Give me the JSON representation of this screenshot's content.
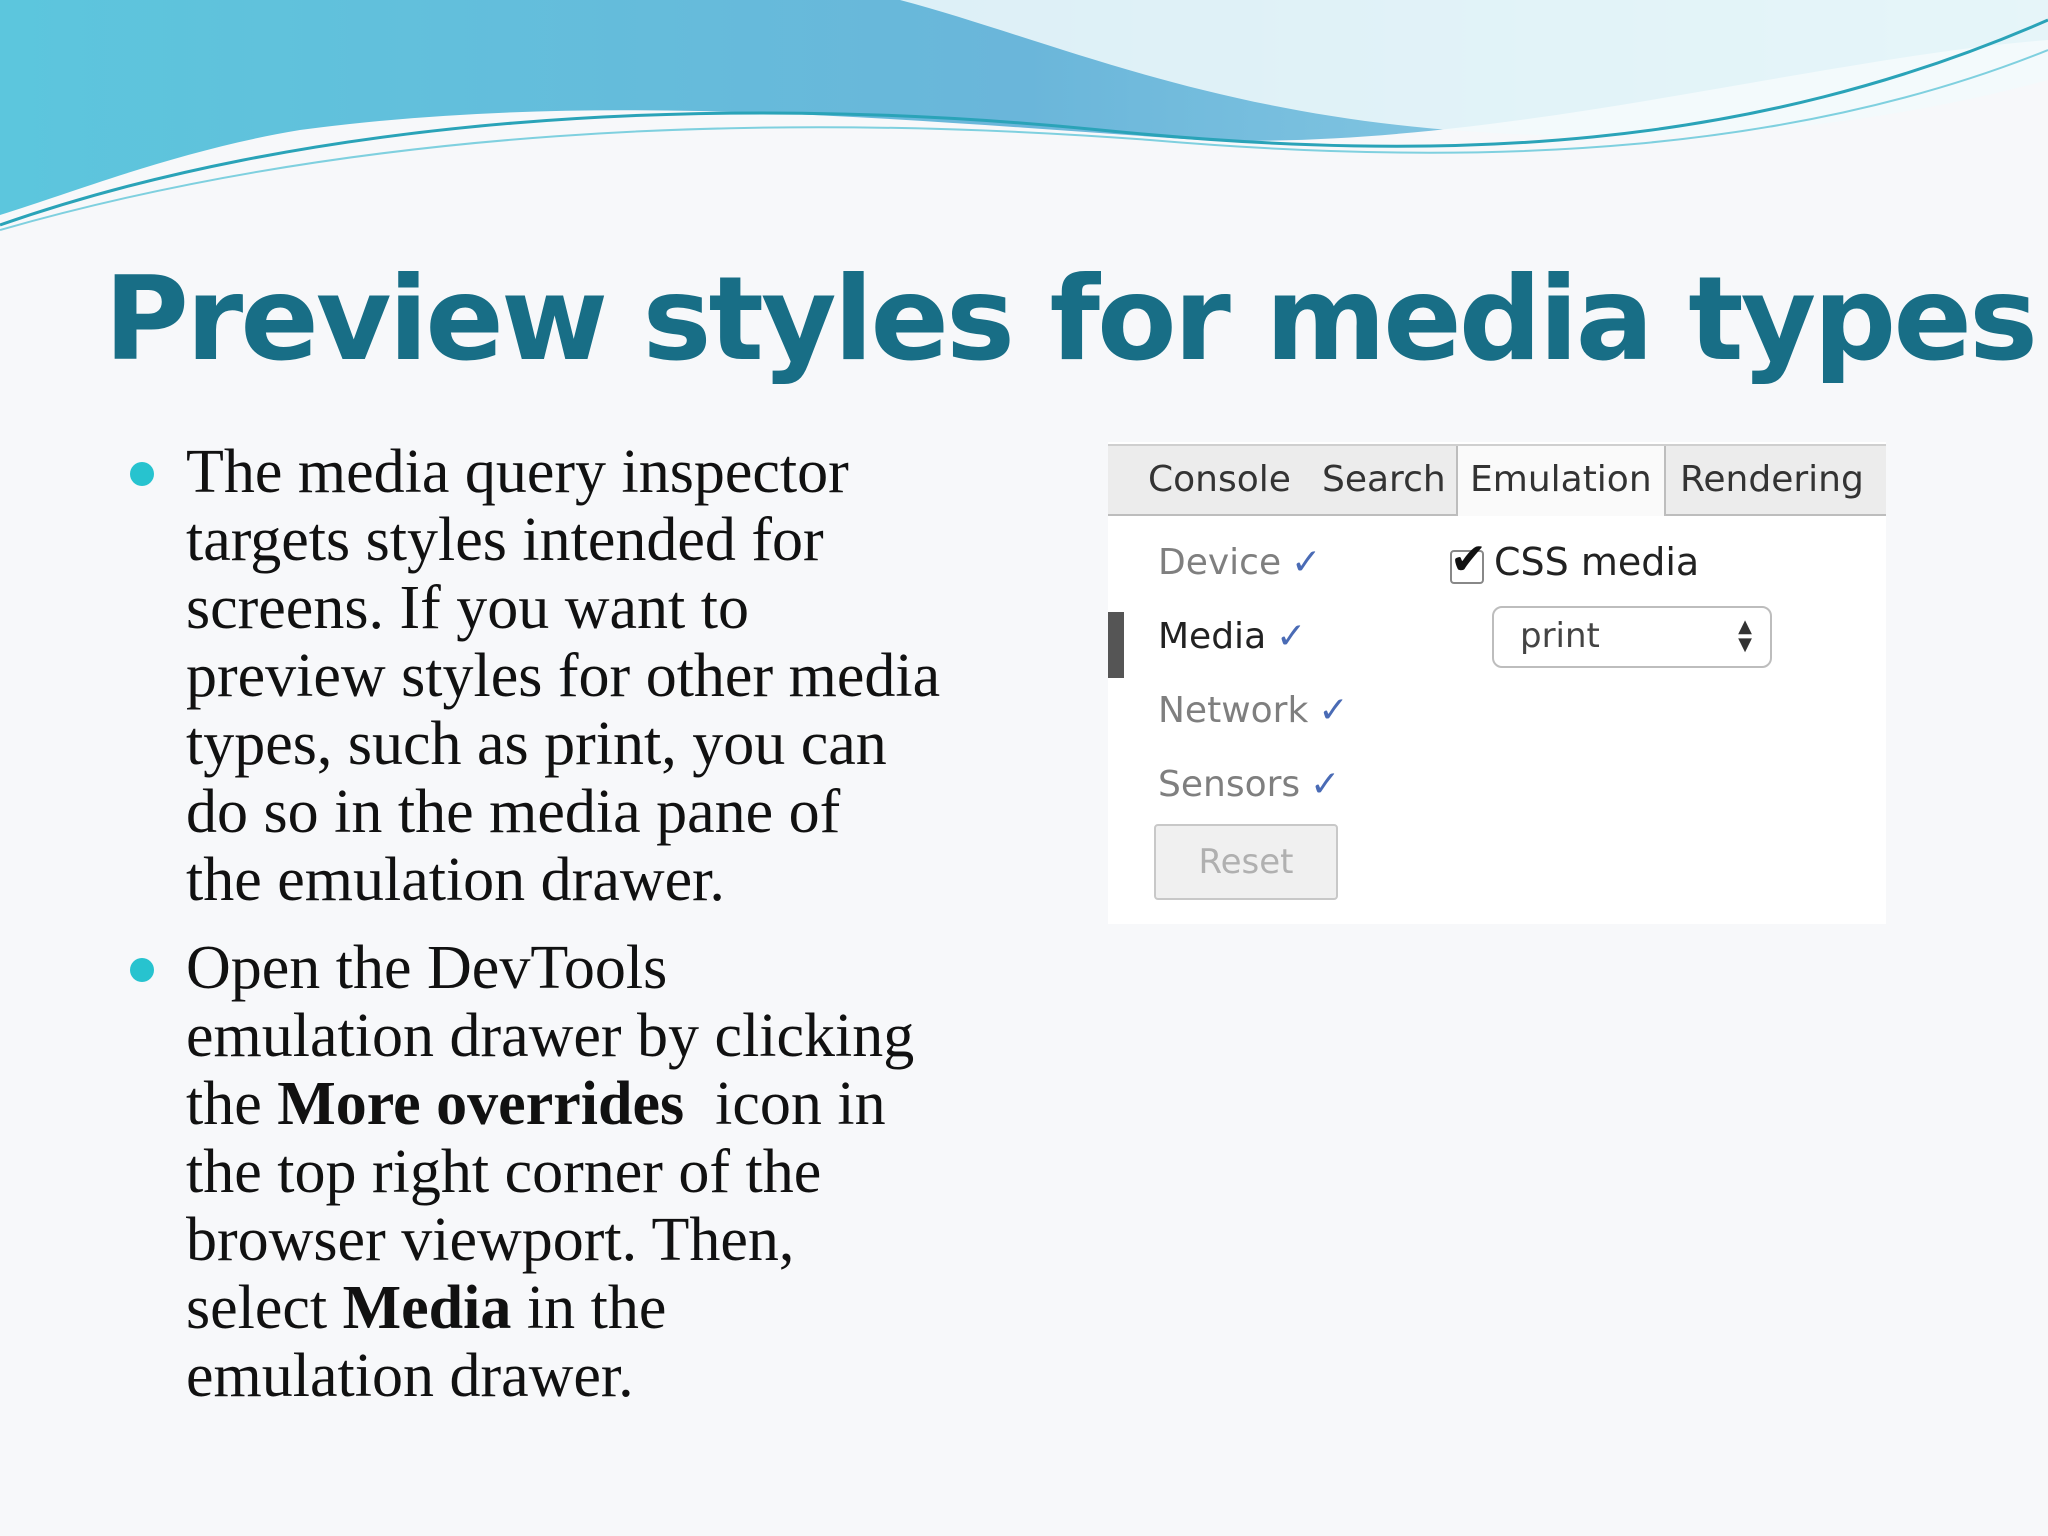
{
  "title": "Preview styles for media types",
  "bullets": [
    {
      "lines": [
        "The media query inspector",
        "targets styles intended for",
        "screens. If you want to",
        "preview styles for other media",
        "types, such as print, you can",
        "do so in the media pane of",
        "the emulation drawer."
      ]
    },
    {
      "line1": "Open the DevTools",
      "line2": "emulation drawer by clicking",
      "line3_a": "the ",
      "line3_bold": "More overrides",
      "line3_b": "  icon in",
      "line4": "the top right corner of the",
      "line5": "browser viewport. Then,",
      "line6_a": "select ",
      "line6_bold": "Media",
      "line6_b": " in the",
      "line7": "emulation drawer."
    }
  ],
  "devtools": {
    "tabs": [
      "Console",
      "Search",
      "Emulation",
      "Rendering"
    ],
    "active_tab": "Emulation",
    "sidebar": [
      {
        "label": "Device",
        "check": "✓"
      },
      {
        "label": "Media",
        "check": "✓"
      },
      {
        "label": "Network",
        "check": "✓"
      },
      {
        "label": "Sensors",
        "check": "✓"
      }
    ],
    "selected_item": "Media",
    "reset_label": "Reset",
    "css_media_label": "CSS media",
    "css_media_checked": true,
    "media_select_value": "print"
  },
  "colors": {
    "title": "#186e86",
    "bullet": "#27c3cf",
    "wave_dark": "#5ab4d6",
    "wave_light": "#a8e4ee"
  }
}
